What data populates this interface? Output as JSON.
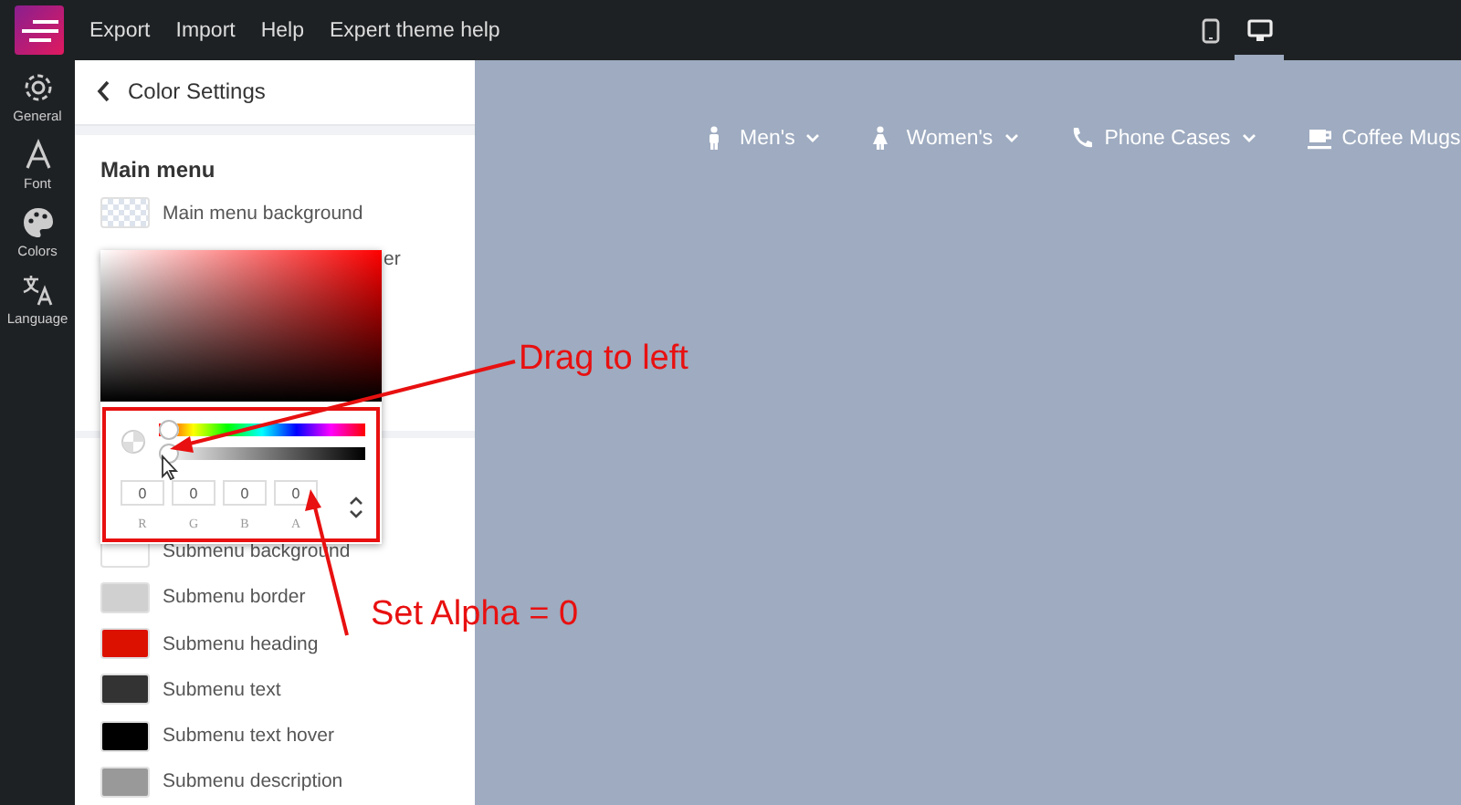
{
  "top_bar": {
    "menu": [
      "Export",
      "Import",
      "Help",
      "Expert theme help"
    ],
    "devices": [
      {
        "kind": "phone",
        "selected": false
      },
      {
        "kind": "desktop",
        "selected": true
      }
    ]
  },
  "rail": [
    {
      "label": "General",
      "kind": "gear"
    },
    {
      "label": "Font",
      "kind": "font"
    },
    {
      "label": "Colors",
      "kind": "palette"
    },
    {
      "label": "Language",
      "kind": "translate"
    }
  ],
  "panel": {
    "title": "Color Settings",
    "section": "Main menu",
    "items": [
      {
        "kind": "transparent",
        "label": "Main menu background"
      },
      {
        "kind": "clipped",
        "label": "er"
      }
    ],
    "submenu_items": [
      {
        "label": "Submenu background",
        "color": "#ffffff"
      },
      {
        "label": "Submenu border",
        "color": "#d0d0d0"
      },
      {
        "label": "Submenu heading",
        "color": "#dd1100"
      },
      {
        "label": "Submenu text",
        "color": "#333333"
      },
      {
        "label": "Submenu text hover",
        "color": "#000000"
      },
      {
        "label": "Submenu description",
        "color": "#999999"
      }
    ]
  },
  "picker": {
    "hue": {
      "level": 0
    },
    "alpha": {
      "level": 0
    },
    "fields": [
      {
        "value": "0",
        "label": "R"
      },
      {
        "value": "0",
        "label": "G"
      },
      {
        "value": "0",
        "label": "B"
      },
      {
        "value": "0",
        "label": "A"
      }
    ]
  },
  "annotations": [
    {
      "kind": "drag",
      "text": "Drag to left"
    },
    {
      "kind": "alpha",
      "text": "Set Alpha = 0"
    }
  ],
  "store_nav": [
    {
      "kind": "man",
      "label": "Men's"
    },
    {
      "kind": "woman",
      "label": "Women's"
    },
    {
      "kind": "phone",
      "label": "Phone Cases"
    },
    {
      "kind": "mug",
      "label": "Coffee Mugs"
    }
  ]
}
